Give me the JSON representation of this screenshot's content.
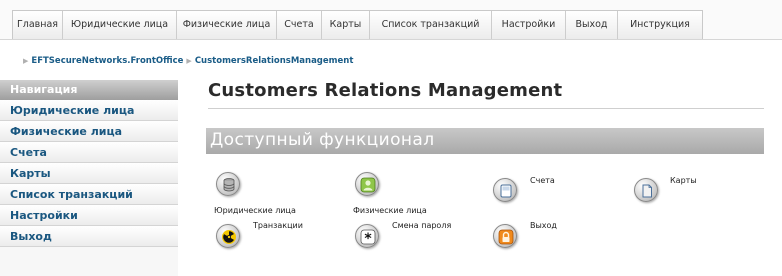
{
  "tabs": [
    "Главная",
    "Юридические лица",
    "Физические лица",
    "Счета",
    "Карты",
    "Список транзакций",
    "Настройки",
    "Выход",
    "Инструкция"
  ],
  "breadcrumb": [
    "EFTSecureNetworks.FrontOffice",
    "CustomersRelationsManagement"
  ],
  "sidebar": {
    "header": "Навигация",
    "items": [
      "Юридические лица",
      "Физические лица",
      "Счета",
      "Карты",
      "Список транзакций",
      "Настройки",
      "Выход"
    ]
  },
  "main": {
    "title": "Customers Relations Management",
    "section_title": "Доступный функционал",
    "functions": [
      {
        "label": "Юридические лица",
        "icon": "database-icon"
      },
      {
        "label": "Физические лица",
        "icon": "user-icon"
      },
      {
        "label": "Счета",
        "icon": "accounts-icon"
      },
      {
        "label": "Карты",
        "icon": "card-icon"
      },
      {
        "label": "Транзакции",
        "icon": "radiation-icon"
      },
      {
        "label": "Смена пароля",
        "icon": "asterisk-icon"
      },
      {
        "label": "Выход",
        "icon": "lock-icon"
      }
    ]
  }
}
